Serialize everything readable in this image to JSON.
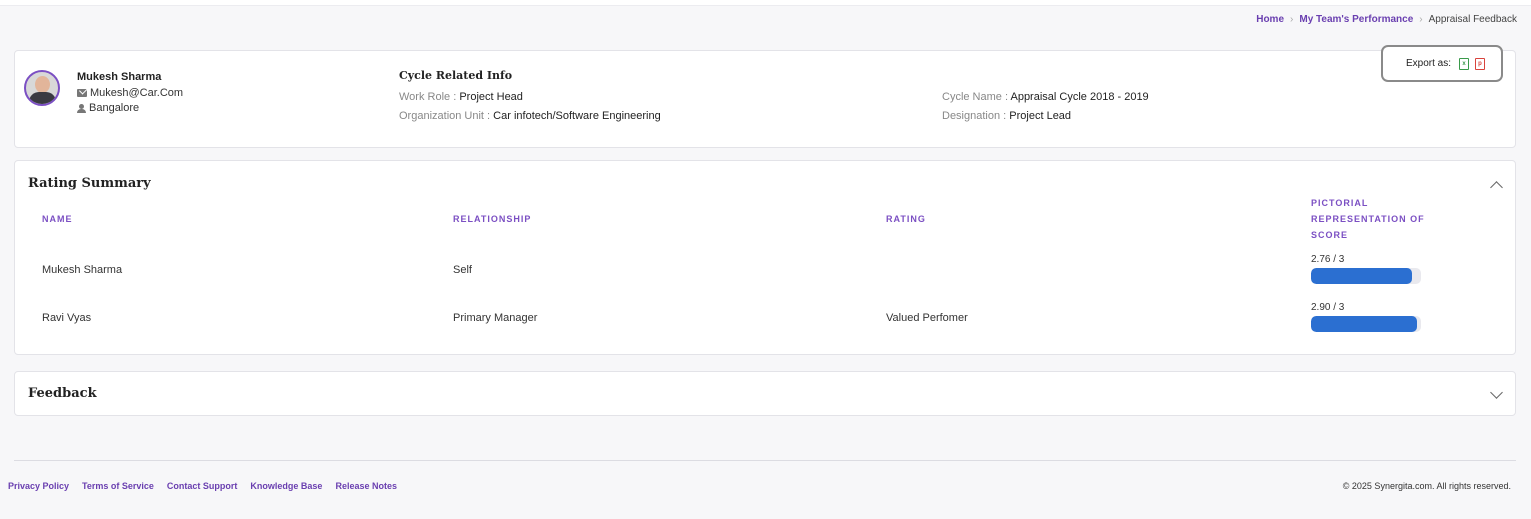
{
  "breadcrumb": {
    "items": [
      "Home",
      "My Team's Performance"
    ],
    "current": "Appraisal Feedback"
  },
  "profile": {
    "name": "Mukesh Sharma",
    "email": "Mukesh@Car.Com",
    "location": "Bangalore",
    "avatar_icon": "user-photo"
  },
  "cycle": {
    "title": "Cycle Related Info",
    "work_role_label": "Work Role :",
    "work_role": "Project Head",
    "org_unit_label": "Organization Unit :",
    "org_unit": "Car infotech/Software Engineering",
    "cycle_name_label": "Cycle Name :",
    "cycle_name": "Appraisal Cycle 2018 - 2019",
    "designation_label": "Designation :",
    "designation": "Project Lead"
  },
  "export": {
    "label": "Export as:",
    "xls_icon": "excel-file-icon",
    "pdf_icon": "pdf-file-icon"
  },
  "rating_summary": {
    "title": "Rating Summary",
    "columns": [
      "NAME",
      "RELATIONSHIP",
      "RATING",
      "PICTORIAL REPRESENTATION OF SCORE"
    ],
    "rows": [
      {
        "name": "Mukesh Sharma",
        "relationship": "Self",
        "rating": "",
        "score_text": "2.76 / 3",
        "score": 2.76,
        "max": 3
      },
      {
        "name": "Ravi Vyas",
        "relationship": "Primary Manager",
        "rating": "Valued Perfomer",
        "score_text": "2.90 / 3",
        "score": 2.9,
        "max": 3
      }
    ],
    "bar_color": "#2b6fd1"
  },
  "feedback": {
    "title": "Feedback"
  },
  "footer": {
    "links": [
      "Privacy Policy",
      "Terms of Service",
      "Contact Support",
      "Knowledge Base",
      "Release Notes"
    ],
    "copyright": "© 2025 Synergita.com. All rights reserved."
  },
  "colors": {
    "accent": "#7b4fc3",
    "link": "#6a3fb0"
  }
}
